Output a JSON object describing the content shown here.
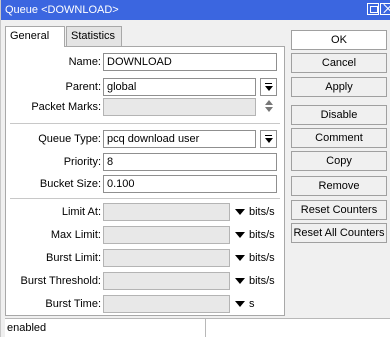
{
  "window": {
    "title": "Queue <DOWNLOAD>",
    "title_color": "#3b66e0"
  },
  "tabs": [
    {
      "label": "General",
      "active": true
    },
    {
      "label": "Statistics",
      "active": false
    }
  ],
  "form": {
    "name": {
      "label": "Name:",
      "value": "DOWNLOAD"
    },
    "parent": {
      "label": "Parent:",
      "value": "global"
    },
    "packet_marks": {
      "label": "Packet Marks:",
      "value": ""
    },
    "queue_type": {
      "label": "Queue Type:",
      "value": "pcq download user"
    },
    "priority": {
      "label": "Priority:",
      "value": "8"
    },
    "bucket_size": {
      "label": "Bucket Size:",
      "value": "0.100"
    },
    "limit_at": {
      "label": "Limit At:",
      "value": "",
      "unit": "bits/s"
    },
    "max_limit": {
      "label": "Max Limit:",
      "value": "",
      "unit": "bits/s"
    },
    "burst_limit": {
      "label": "Burst Limit:",
      "value": "",
      "unit": "bits/s"
    },
    "burst_threshold": {
      "label": "Burst Threshold:",
      "value": "",
      "unit": "bits/s"
    },
    "burst_time": {
      "label": "Burst Time:",
      "value": "",
      "unit": "s"
    }
  },
  "buttons": {
    "ok": "OK",
    "cancel": "Cancel",
    "apply": "Apply",
    "disable": "Disable",
    "comment": "Comment",
    "copy": "Copy",
    "remove": "Remove",
    "reset_counters": "Reset Counters",
    "reset_all_counters": "Reset All Counters"
  },
  "icons": {
    "restore": "restore-icon",
    "close": "close-icon",
    "dropdown": "dropdown-arrow-icon",
    "updown": "updown-arrows-icon",
    "expand": "expand-triangle-icon"
  },
  "status": {
    "text": "enabled"
  }
}
